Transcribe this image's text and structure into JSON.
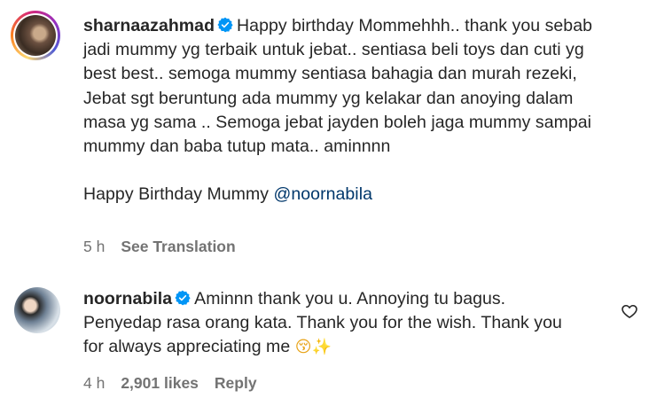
{
  "comments": [
    {
      "username": "sharnaazahmad",
      "text": "Happy birthday Mommehhh.. thank you sebab jadi mummy yg terbaik untuk jebat.. sentiasa beli toys dan cuti yg best best.. semoga mummy sentiasa bahagia dan murah rezeki, Jebat sgt beruntung ada mummy yg kelakar dan anoying dalam masa yg sama .. Semoga jebat jayden boleh jaga mummy sampai mummy dan baba tutup mata.. aminnnn",
      "text2": "Happy Birthday Mummy",
      "mention": "@noornabila",
      "time": "5 h",
      "see_translation": "See Translation"
    },
    {
      "username": "noornabila",
      "text": "Aminnn thank you u. Annoying tu bagus. Penyedap rasa orang kata. Thank you for the wish. Thank you for always appreciating me",
      "emoji1": "😚",
      "emoji2": "✨",
      "time": "4 h",
      "likes": "2,901 likes",
      "reply": "Reply"
    }
  ],
  "colors": {
    "text": "#262626",
    "secondary": "#737373",
    "mention": "#00376b",
    "verified": "#0095f6"
  },
  "icons": [
    "verified-badge-icon",
    "heart-icon"
  ]
}
